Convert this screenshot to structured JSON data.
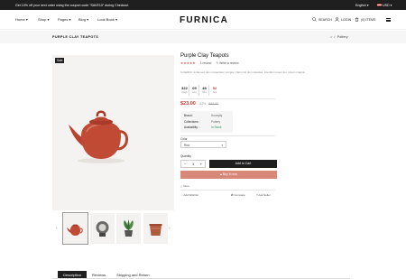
{
  "topbar": {
    "promo": "Get 10% off your next order using the coupon code \"SAVE10\" during Checkout",
    "language": "English",
    "currency": "USD"
  },
  "header": {
    "logo": "FURNICA",
    "nav": [
      "Home",
      "Shop",
      "Pages",
      "Blog",
      "Look Book"
    ],
    "search_label": "SEARCH",
    "login_label": "LOGIN",
    "cart_label": "(0) ITEMS"
  },
  "breadcrumb": {
    "title": "PURPLE CLAY TEAPOTS",
    "home_glyph": "⌂",
    "separator": "/",
    "current": "Pottery"
  },
  "product": {
    "sale_badge": "Sale",
    "title": "Purple Clay Teapots",
    "stars": "★★★★★",
    "review_count": "1 review",
    "write_review": "Write a review",
    "description": "Cobalithic ut dia sed dos consectetur congue. Nam nisl nisi molestas, interdum lorem leo, ipsum magna.",
    "countdown": [
      {
        "num": "322",
        "label": "Days"
      },
      {
        "num": "09",
        "label": "Hrs"
      },
      {
        "num": "48",
        "label": "Min"
      },
      {
        "num": "52",
        "label": "Sec"
      }
    ],
    "price": "$23.00",
    "discount": "-43%",
    "old_price": "$40.00",
    "meta": [
      {
        "k": "Brand :",
        "v": "Honeylly"
      },
      {
        "k": "Collections :",
        "v": "Pottery"
      },
      {
        "k": "Availability :",
        "v": "In Stock"
      }
    ],
    "color_label": "Color",
    "color_value": "Red",
    "quantity_label": "Quantity",
    "quantity_value": "1",
    "qty_minus": "−",
    "qty_plus": "+",
    "add_to_cart": "Add to Cart",
    "buy_now": "Buy it now",
    "more_info": "△ More",
    "wishlist": "Add Wishlist",
    "compare": "Compare",
    "ask": "Ask Seller"
  },
  "thumbs_nav": {
    "prev": "‹",
    "next": "›"
  },
  "tabs": [
    "Description",
    "Reviews",
    "Shipping and Return"
  ],
  "colors": {
    "accent": "#c23b2f",
    "buy_now": "#d88878",
    "dark": "#1f1f1f"
  }
}
